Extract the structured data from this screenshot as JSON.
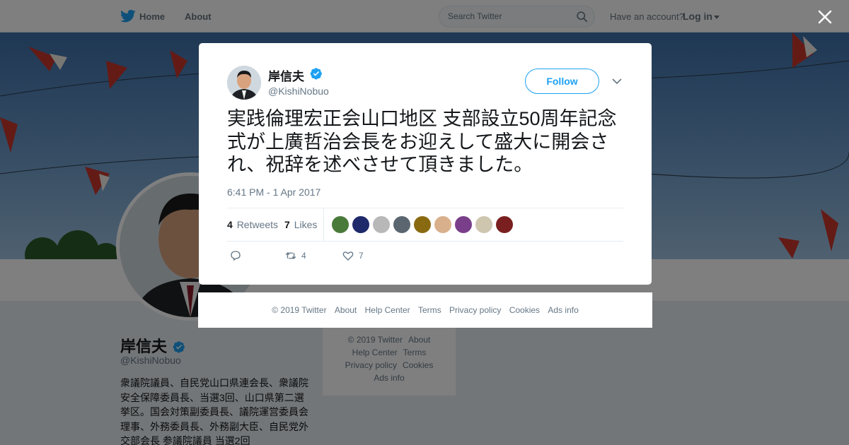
{
  "topbar": {
    "nav_home": "Home",
    "nav_about": "About",
    "search_placeholder": "Search Twitter",
    "account_prompt": "Have an account?",
    "login_label": "Log in"
  },
  "profile": {
    "name": "岸信夫",
    "handle": "@KishiNobuo",
    "bio": "衆議院議員、自民党山口県連会長、衆議院安全保障委員長、当選3回、山口県第二選挙区。国会対策副委員長、議院運営委員会理事、外務委員長、外務副大臣、自民党外交部会長 参議院議員 当選2回"
  },
  "side_footer": {
    "links": [
      "© 2019 Twitter",
      "About",
      "Help Center",
      "Terms",
      "Privacy policy",
      "Cookies",
      "Ads info"
    ]
  },
  "tweet": {
    "author_name": "岸信夫",
    "author_handle": "@KishiNobuo",
    "follow_label": "Follow",
    "text": "実践倫理宏正会山口地区 支部設立50周年記念式が上廣哲治会長をお迎えして盛大に開会され、祝辞を述べさせて頂きました。",
    "timestamp": "6:41 PM - 1 Apr 2017",
    "retweets_count": "4",
    "retweets_label": "Retweets",
    "likes_count": "7",
    "likes_label": "Likes",
    "action_retweet_count": "4",
    "action_like_count": "7",
    "liker_colors": [
      "#4a7a3a",
      "#1f2a6b",
      "#b8b8b8",
      "#5b6670",
      "#8a6a10",
      "#d9b08c",
      "#7a3f8a",
      "#cfc6b0",
      "#7a1f1f"
    ]
  },
  "modal_footer": {
    "links": [
      "© 2019 Twitter",
      "About",
      "Help Center",
      "Terms",
      "Privacy policy",
      "Cookies",
      "Ads info"
    ]
  },
  "colors": {
    "brand_blue": "#1da1f2",
    "overlay": "rgba(0,0,0,0.5)"
  }
}
